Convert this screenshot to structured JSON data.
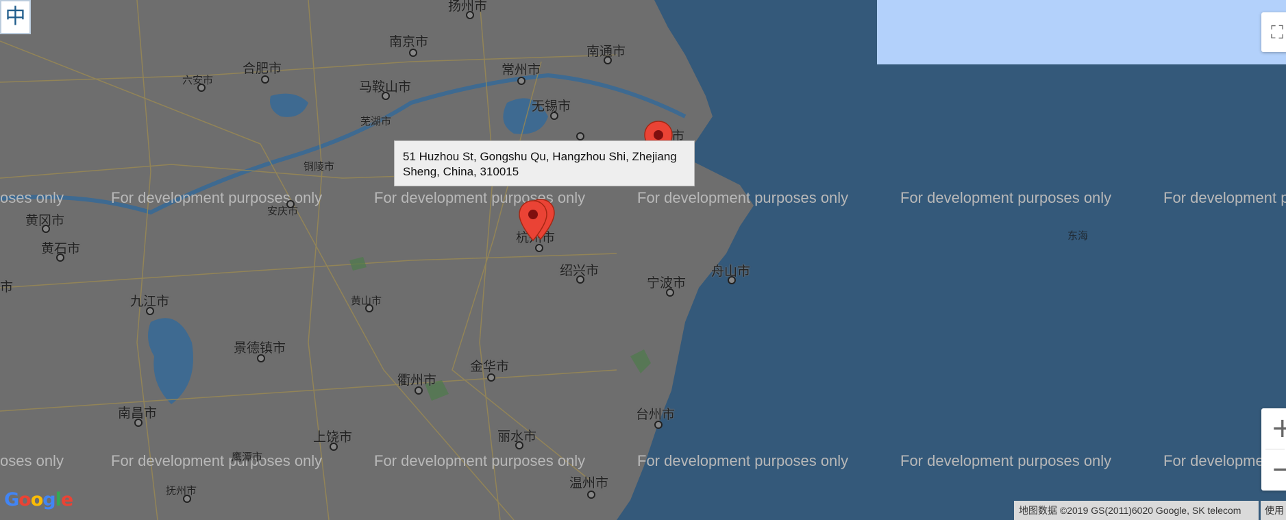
{
  "controls": {
    "language_label": "中",
    "fullscreen_icon": "fullscreen-icon",
    "zoom_in_label": "+",
    "zoom_out_label": "−"
  },
  "info_window": {
    "address_line1": "51 Huzhou St, Gongshu Qu, Hangzhou Shi, Zhejiang",
    "address_line2": "Sheng, China, 310015"
  },
  "watermark_text": "For development purposes only",
  "partial_watermarks": {
    "left_top": "oses only",
    "left_bottom": "oses only",
    "right_top": "For development p",
    "right_bottom": "For developme"
  },
  "cities": [
    {
      "name": "扬州市",
      "id": "yangzhou"
    },
    {
      "name": "南京市",
      "id": "nanjing"
    },
    {
      "name": "南通市",
      "id": "nantong"
    },
    {
      "name": "合肥市",
      "id": "hefei"
    },
    {
      "name": "常州市",
      "id": "changzhou"
    },
    {
      "name": "六安市",
      "id": "luan"
    },
    {
      "name": "马鞍山市",
      "id": "maanshan"
    },
    {
      "name": "无锡市",
      "id": "wuxi"
    },
    {
      "name": "芜湖市",
      "id": "wuhu"
    },
    {
      "name": "铜陵市",
      "id": "tongling"
    },
    {
      "name": "市",
      "id": "shanghai-partial"
    },
    {
      "name": "安庆市",
      "id": "anqing"
    },
    {
      "name": "黄冈市",
      "id": "huanggang"
    },
    {
      "name": "黄石市",
      "id": "huangshi"
    },
    {
      "name": "杭州市",
      "id": "hangzhou"
    },
    {
      "name": "绍兴市",
      "id": "shaoxing"
    },
    {
      "name": "舟山市",
      "id": "zhoushan"
    },
    {
      "name": "宁波市",
      "id": "ningbo"
    },
    {
      "name": "九江市",
      "id": "jiujiang"
    },
    {
      "name": "黄山市",
      "id": "huangshan"
    },
    {
      "name": "景德镇市",
      "id": "jingdezhen"
    },
    {
      "name": "金华市",
      "id": "jinhua"
    },
    {
      "name": "衢州市",
      "id": "quzhou"
    },
    {
      "name": "南昌市",
      "id": "nanchang"
    },
    {
      "name": "台州市",
      "id": "taizhou"
    },
    {
      "name": "上饶市",
      "id": "shangrao"
    },
    {
      "name": "丽水市",
      "id": "lishui"
    },
    {
      "name": "鹰潭市",
      "id": "yingtan"
    },
    {
      "name": "温州市",
      "id": "wenzhou"
    },
    {
      "name": "抚州市",
      "id": "fuzhou"
    },
    {
      "name": "市",
      "id": "left-partial"
    }
  ],
  "sea_label": "东海",
  "attribution": "地图数据 ©2019 GS(2011)6020 Google, SK telecom",
  "terms_label": "使用",
  "logo_text": "Google",
  "colors": {
    "land": "#6e6e6e",
    "sea": "#34597a",
    "marker": "#ea4335",
    "overlay": "#b3d1fb"
  }
}
